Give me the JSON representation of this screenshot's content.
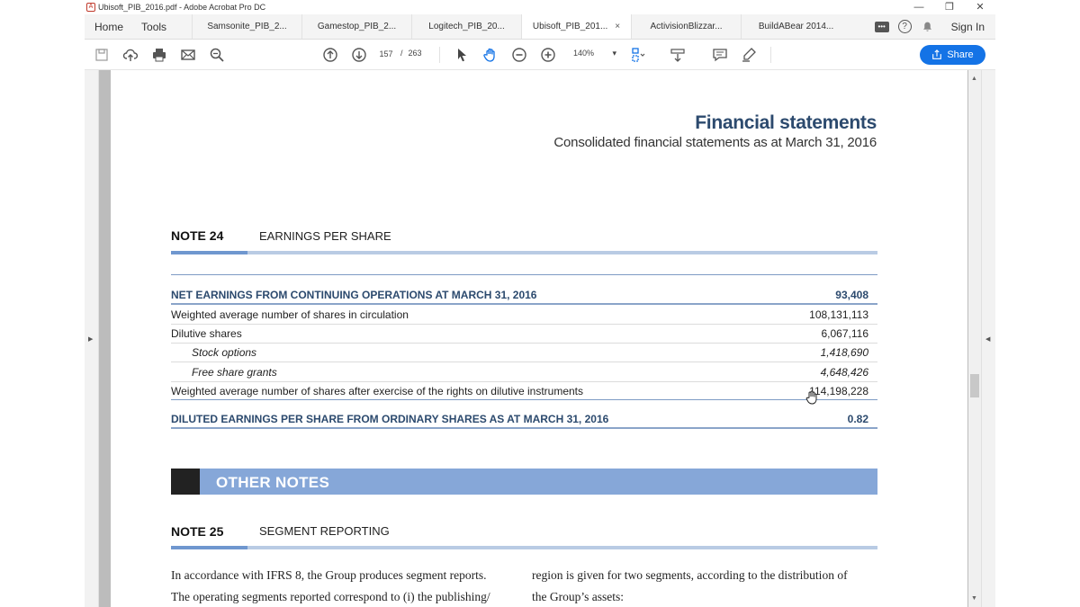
{
  "window": {
    "title": "Ubisoft_PIB_2016.pdf - Adobe Acrobat Pro DC",
    "controls": {
      "minimize": "—",
      "restore": "❐",
      "close": "✕"
    }
  },
  "nav": {
    "home": "Home",
    "tools": "Tools"
  },
  "tabs": [
    {
      "label": "Samsonite_PIB_2...",
      "active": false
    },
    {
      "label": "Gamestop_PIB_2...",
      "active": false
    },
    {
      "label": "Logitech_PIB_20...",
      "active": false
    },
    {
      "label": "Ubisoft_PIB_201...",
      "active": true,
      "close": "×"
    },
    {
      "label": "ActivisionBlizzar...",
      "active": false
    },
    {
      "label": "BuildABear 2014...",
      "active": false
    }
  ],
  "header_right": {
    "sign_in": "Sign In",
    "help": "?"
  },
  "toolbar": {
    "page_current": "157",
    "page_separator": "/",
    "page_total": "263",
    "zoom": "140%",
    "zoom_caret": "▾",
    "share_label": "Share"
  },
  "icons": {
    "save": "save-icon",
    "upload": "cloud-upload-icon",
    "print": "print-icon",
    "email": "mail-icon",
    "search": "zoom-search-icon",
    "prev": "page-up-icon",
    "next": "page-down-icon",
    "select": "cursor-arrow-icon",
    "hand": "hand-tool-icon",
    "zoom_out": "zoom-out-icon",
    "zoom_in": "zoom-in-icon",
    "fit": "fit-page-icon",
    "scroll": "scroll-mode-icon",
    "comment": "comment-icon",
    "highlight": "highlight-pen-icon"
  },
  "document": {
    "header_title": "Financial statements",
    "header_subtitle": "Consolidated financial statements as at March 31, 2016",
    "note24": {
      "label": "NOTE 24",
      "title": "EARNINGS PER SHARE"
    },
    "eps_table": [
      {
        "label": "NET EARNINGS FROM CONTINUING OPERATIONS AT MARCH 31, 2016",
        "value": "93,408",
        "style": "bold"
      },
      {
        "label": "Weighted average number of shares in circulation",
        "value": "108,131,113",
        "style": "normal"
      },
      {
        "label": "Dilutive shares",
        "value": "6,067,116",
        "style": "normal"
      },
      {
        "label": "Stock options",
        "value": "1,418,690",
        "style": "italic"
      },
      {
        "label": "Free share grants",
        "value": "4,648,426",
        "style": "italic"
      },
      {
        "label": "Weighted average number of shares after exercise of the rights on dilutive instruments",
        "value": "114,198,228",
        "style": "normal"
      },
      {
        "label": "DILUTED EARNINGS PER SHARE FROM ORDINARY SHARES AS AT MARCH 31, 2016",
        "value": "0.82",
        "style": "bold"
      }
    ],
    "other_notes": "OTHER NOTES",
    "note25": {
      "label": "NOTE 25",
      "title": "SEGMENT REPORTING"
    },
    "body_left": [
      "In accordance with IFRS 8, the Group produces segment reports.",
      "The operating segments reported correspond to (i) the publishing/"
    ],
    "body_right": [
      "region is given for two segments, according to the distribution of",
      "the Group’s assets:"
    ]
  }
}
